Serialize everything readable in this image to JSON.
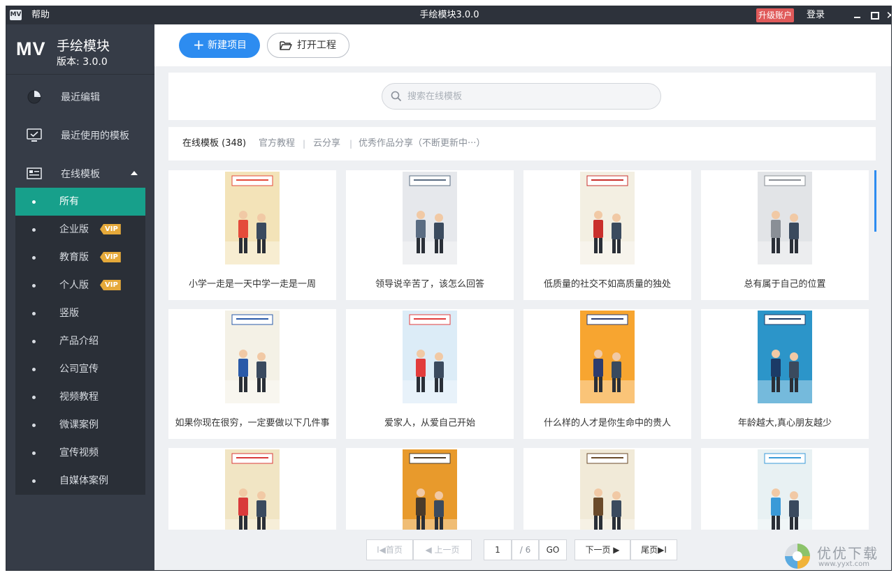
{
  "titlebar": {
    "app_icon": "MV",
    "help": "帮助",
    "title": "手绘模块3.0.0",
    "upgrade": "升级账户",
    "login": "登录",
    "close": "✕"
  },
  "sidebar": {
    "logo": "MV",
    "app_name": "手绘模块",
    "version": "版本: 3.0.0",
    "nav": [
      {
        "label": "最近编辑",
        "icon": "pie-chart-icon"
      },
      {
        "label": "最近使用的模板",
        "icon": "monitor-check-icon"
      },
      {
        "label": "在线模板",
        "icon": "template-list-icon"
      }
    ],
    "sub_items": [
      {
        "label": "所有",
        "vip": "",
        "active": true
      },
      {
        "label": "企业版",
        "vip": "VIP"
      },
      {
        "label": "教育版",
        "vip": "VIP"
      },
      {
        "label": "个人版",
        "vip": "VIP"
      },
      {
        "label": "竖版",
        "vip": ""
      },
      {
        "label": "产品介绍",
        "vip": ""
      },
      {
        "label": "公司宣传",
        "vip": ""
      },
      {
        "label": "视频教程",
        "vip": ""
      },
      {
        "label": "微课案例",
        "vip": ""
      },
      {
        "label": "宣传视频",
        "vip": ""
      },
      {
        "label": "自媒体案例",
        "vip": ""
      }
    ]
  },
  "toolbar": {
    "new_project": "新建项目",
    "open_project": "打开工程"
  },
  "search": {
    "placeholder": "搜索在线模板"
  },
  "tabs": [
    {
      "label": "在线模板 (348)",
      "active": true
    },
    {
      "label": "官方教程"
    },
    {
      "label": "云分享"
    },
    {
      "label": "优秀作品分享（不断更新中···）"
    }
  ],
  "tab_separator": "|",
  "cards": [
    {
      "title": "小学一走是一天中学一走是一周",
      "bg": "#f3e3b8",
      "accent": "#e44b3a"
    },
    {
      "title": "领导说辛苦了，该怎么回答",
      "bg": "#e6e8ec",
      "accent": "#5a6c82"
    },
    {
      "title": "低质量的社交不如高质量的独处",
      "bg": "#f3efe2",
      "accent": "#c9302c"
    },
    {
      "title": "总有属于自己的位置",
      "bg": "#e2e4e7",
      "accent": "#8a8f96"
    },
    {
      "title": "如果你现在很穷，一定要做以下几件事",
      "bg": "#f4f1e6",
      "accent": "#2a5aa8"
    },
    {
      "title": "爱家人，从爱自己开始",
      "bg": "#dcecf7",
      "accent": "#e23c3c"
    },
    {
      "title": "什么样的人才是你生命中的贵人",
      "bg": "#f7a530",
      "accent": "#2d3c6e"
    },
    {
      "title": "年龄越大,真心朋友越少",
      "bg": "#2c95c9",
      "accent": "#1b3a66"
    },
    {
      "title": "",
      "bg": "#f1e5c4",
      "accent": "#d93a3a"
    },
    {
      "title": "",
      "bg": "#e89a2c",
      "accent": "#4a3b2a"
    },
    {
      "title": "",
      "bg": "#f1ead8",
      "accent": "#6a4a2a"
    },
    {
      "title": "",
      "bg": "#e8f1f3",
      "accent": "#3a9ad8"
    }
  ],
  "pagination": {
    "first": "I◀首页",
    "prev": "◀ 上一页",
    "page": "1",
    "total": "/ 6",
    "go": "GO",
    "next": "下一页 ▶",
    "last": "尾页▶I"
  },
  "watermark": {
    "name": "优优下载",
    "url": "www.yyxt.com"
  }
}
